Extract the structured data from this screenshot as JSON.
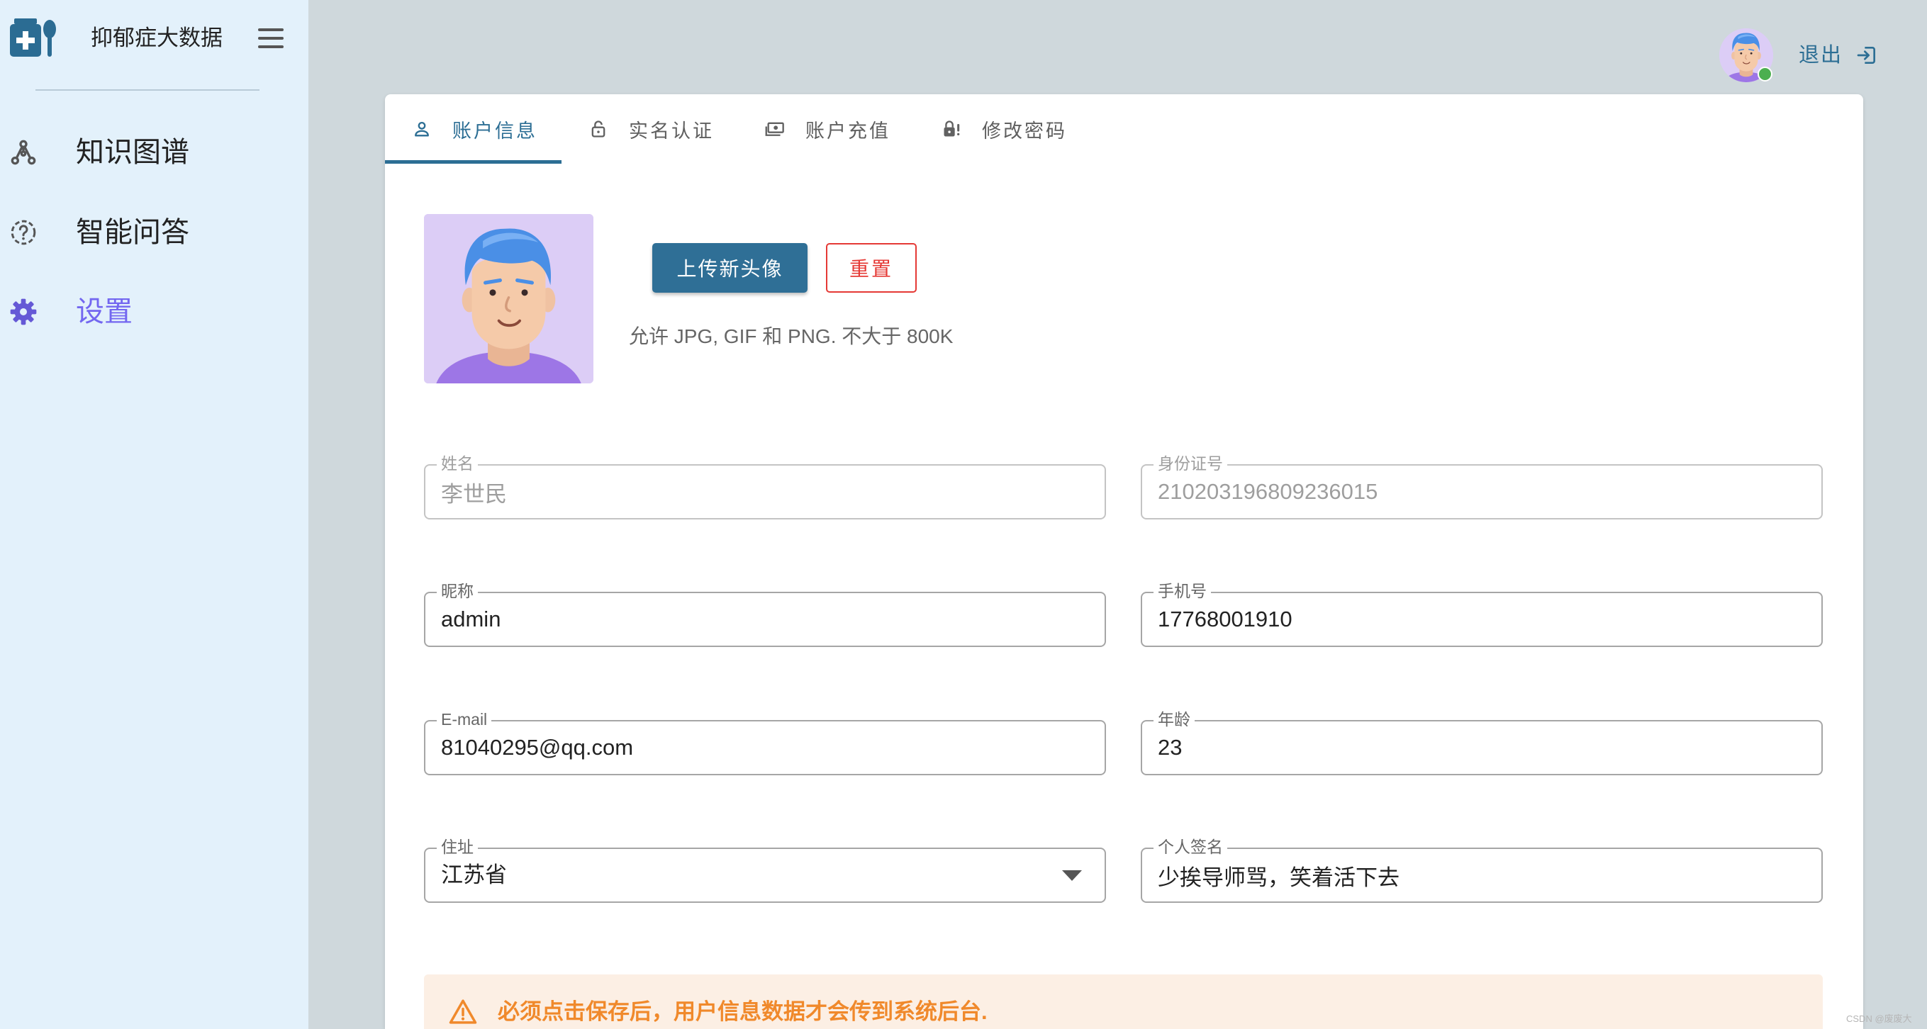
{
  "app": {
    "title": "抑郁症大数据",
    "logo_icon": "medical-kit-spoon-icon"
  },
  "sidebar": {
    "menu_icon": "hamburger-icon",
    "items": [
      {
        "label": "知识图谱",
        "icon": "graph-icon",
        "active": false
      },
      {
        "label": "智能问答",
        "icon": "question-circle-icon",
        "active": false
      },
      {
        "label": "设置",
        "icon": "gear-icon",
        "active": true
      }
    ]
  },
  "header": {
    "logout_label": "退出",
    "logout_icon": "logout-icon",
    "online": true
  },
  "tabs": [
    {
      "label": "账户信息",
      "icon": "person-icon",
      "active": true
    },
    {
      "label": "实名认证",
      "icon": "lock-open-icon",
      "active": false
    },
    {
      "label": "账户充值",
      "icon": "cash-icon",
      "active": false
    },
    {
      "label": "修改密码",
      "icon": "lock-alert-icon",
      "active": false
    }
  ],
  "avatar_section": {
    "upload_label": "上传新头像",
    "reset_label": "重置",
    "hint": "允许 JPG, GIF 和 PNG. 不大于 800K"
  },
  "form": {
    "name": {
      "label": "姓名",
      "value": "李世民",
      "disabled": true
    },
    "id_number": {
      "label": "身份证号",
      "value": "210203196809236015",
      "disabled": true
    },
    "nickname": {
      "label": "昵称",
      "value": "admin"
    },
    "phone": {
      "label": "手机号",
      "value": "17768001910"
    },
    "email": {
      "label": "E-mail",
      "value": "81040295@qq.com"
    },
    "age": {
      "label": "年龄",
      "value": "23"
    },
    "address": {
      "label": "住址",
      "value": "江苏省"
    },
    "signature": {
      "label": "个人签名",
      "value": "少挨导师骂，笑着活下去"
    }
  },
  "alert": {
    "icon": "warning-icon",
    "text": "必须点击保存后，用户信息数据才会传到系统后台."
  },
  "watermark": "CSDN @废废大",
  "colors": {
    "accent": "#2c6e94",
    "nav_active": "#7367f0",
    "danger": "#e53935",
    "warning": "#f0892b",
    "warning_bg": "#fcefe4",
    "online": "#4caf50",
    "sidebar_bg": "#e3f1fb",
    "page_bg": "#cfd8dc"
  }
}
